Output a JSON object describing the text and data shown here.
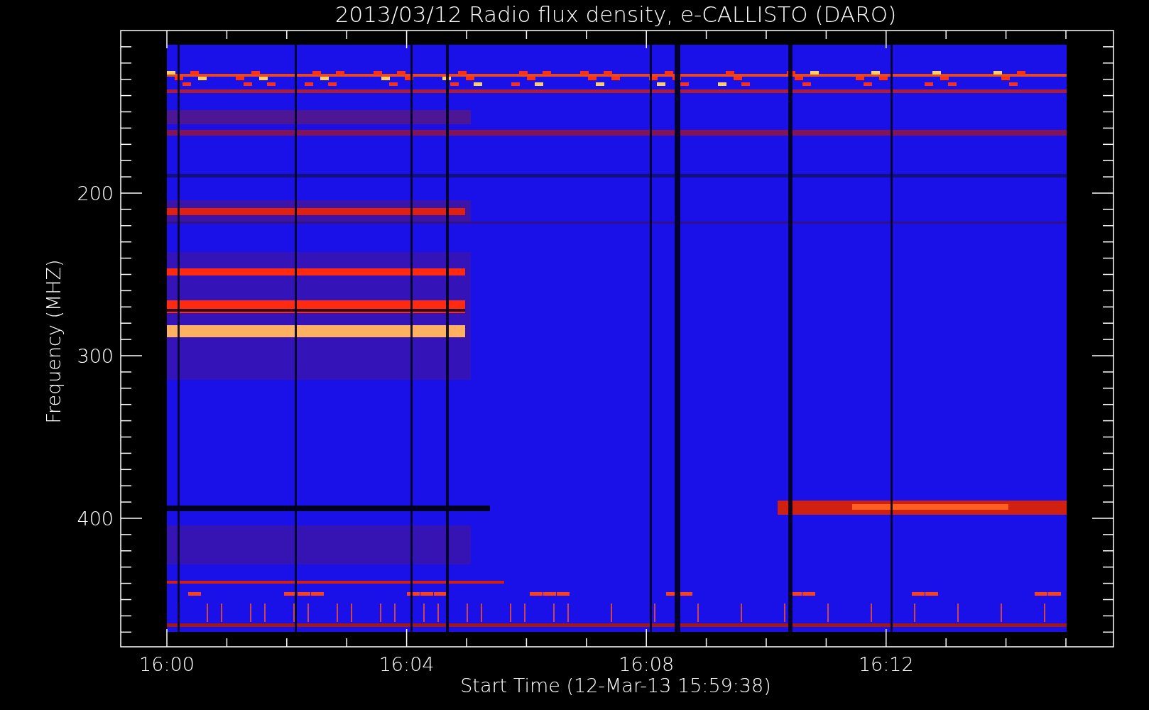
{
  "plot": {
    "title": "2013/03/12  Radio flux density, e-CALLISTO (DARO)",
    "ylabel": "Frequency (MHZ)",
    "xlabel": "Start Time (12-Mar-13 15:59:38)",
    "yticks": [
      "200",
      "300",
      "400"
    ],
    "xticks": [
      "16:00",
      "16:04",
      "16:08",
      "16:12"
    ]
  }
}
